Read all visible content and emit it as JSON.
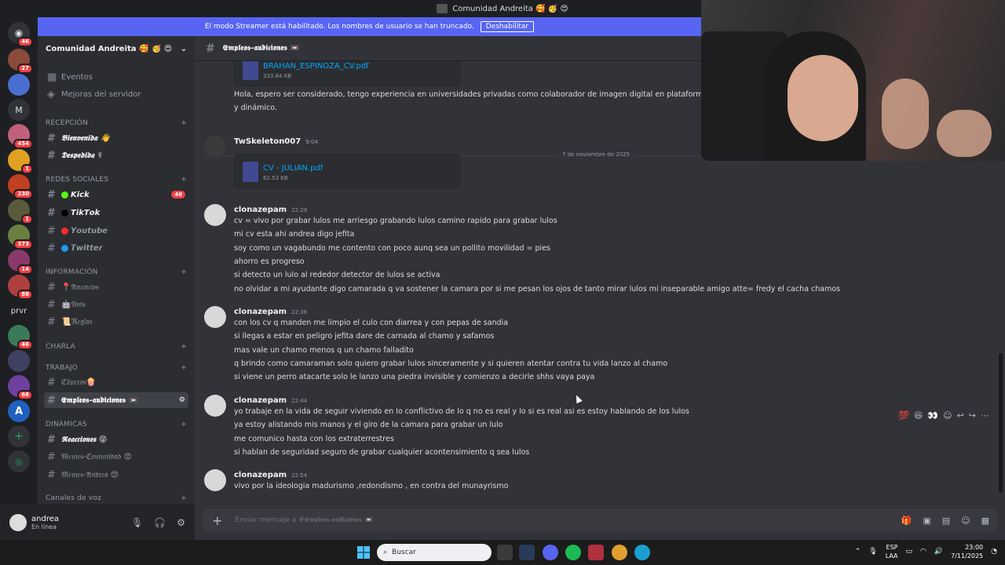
{
  "window": {
    "title": "Comunidad Andreita 🥰 🥳 😍"
  },
  "banner": {
    "text": "El modo Streamer está habilitado. Los nombres de usuario se han truncado.",
    "button": "Deshabilitar"
  },
  "guild_badges": [
    "46",
    "27",
    "454",
    "1",
    "230",
    "1",
    "373",
    "14",
    "88",
    "46",
    "68"
  ],
  "guild_text": {
    "m": "M",
    "prvr": "prvr"
  },
  "server": {
    "name": "Comunidad Andreita 🥰 🥳 😍"
  },
  "sidebar": {
    "top_items": [
      "Eventos",
      "Mejoras del servidor"
    ],
    "categories": {
      "recepcion": "RECEPCIÓN",
      "redes": "REDES SOCIALES",
      "informacion": "INFORMACIÓN",
      "charla": "CHARLA",
      "trabajo": "TRABAJO",
      "dinamicas": "DINAMICAS",
      "voz": "Canales de voz"
    },
    "channels": {
      "bienvenida": "𝕭𝖎𝖊𝖓𝖛𝖊𝖓𝖎𝖉𝖆 👋",
      "despedida": "𝕯𝖊𝖘𝖕𝖊𝖉𝖎𝖉𝖆 ✌",
      "kick": "𝙆𝙞𝙘𝙠",
      "tiktok": "𝙏𝙞𝙠𝙏𝙤𝙠",
      "youtube": "𝙔𝙤𝙪𝙩𝙪𝙗𝙚",
      "twitter": "𝙏𝙬𝙞𝙩𝙩𝙚𝙧",
      "anuncios": "📍𝔄𝔫𝔲𝔫𝔠𝔦𝔬𝔰",
      "bots": "🤖𝔅𝔬𝔱𝔰",
      "reglas": "📜ℜ𝔢𝔤𝔩𝔞𝔰",
      "clipers": "ℭ𝔩𝔦𝔭𝔢𝔯𝔬𝔰🍿",
      "empleos": "𝕰𝖒𝖕𝖑𝖊𝖔𝖘-𝖆𝖚𝖉𝖎𝖈𝖎𝖔𝖓𝖊𝖘 📼",
      "reacciones": "𝕽𝖊𝖆𝖈𝖈𝖎𝖔𝖓𝖊𝖘 😝",
      "memes_comunidad": "𝔐𝔢𝔪𝔢𝔰-ℭ𝔬𝔪𝔲𝔫𝔦𝔡𝔞𝔡 😡",
      "memes_andrea": "𝔐𝔢𝔪𝔢𝔰-𝔄𝔫𝔡𝔯𝔢𝔞 😍"
    },
    "kick_badge": "46"
  },
  "user": {
    "name": "andrea",
    "status": "En línea"
  },
  "channel_header": {
    "name": "𝕰𝖒𝖕𝖑𝖊𝖔𝖘-𝖆𝖚𝖉𝖎𝖈𝖎𝖔𝖓𝖊𝖘 📼"
  },
  "messages": {
    "attach1": {
      "name": "BRAHAN_ESPINOZA_CV.pdf",
      "size": "333.64 KB"
    },
    "prev_text1": "Hola, espero ser considerado, tengo experiencia en universidades privadas como colaborador de imagen digital en plataformas. Tam",
    "prev_text2": "y dinámico.",
    "date_divider": "7 de noviembre de 2025",
    "m1": {
      "user": "TwSkeleton007",
      "time": "9:04",
      "file": "CV - JULIAN.pdf",
      "size": "62.53 KB"
    },
    "m2": {
      "user": "clonazepam",
      "time": "22:29",
      "lines": [
        "cv = vivo por grabar lulos me arriesgo grabando lulos   camino rapido para grabar lulos",
        "mi cv esta ahi andrea digo jefita",
        "soy como un vagabundo me contento con poco aunq sea un pollito movilidad = pies",
        "ahorro es progreso",
        "si detecto un lulo al rededor detector de lulos se activa",
        "no olvidar a mi ayudante digo camarada q va sostener la camara   por si me pesan los ojos de tanto mirar lulos mi  inseparable amigo  atte= fredy  el cacha chamos"
      ]
    },
    "m3": {
      "user": "clonazepam",
      "time": "22:36",
      "lines": [
        "con los cv q manden me limpio el culo con diarrea y con pepas de sandia",
        "si llegas a estar en peligro jefita  dare de carnada al chamo y safamos",
        "mas vale un chamo menos  q un chamo  falladito",
        "q brindo como camaraman solo quiero grabar lulos sinceramente y si quieren atentar contra tu vida lanzo al chamo",
        "si viene un perro atacarte solo le lanzo una piedra invisible y comienzo a decirle shhs vaya paya"
      ]
    },
    "m4": {
      "user": "clonazepam",
      "time": "22:44",
      "lines": [
        "yo trabaje en la vida de seguir viviendo en lo conflictivo de lo q no es real y lo si es real asi es estoy hablando de los lulos",
        "ya estoy alistando mis manos y el giro de la camara para grabar un lulo",
        "me comunico hasta con los extraterrestres",
        "si hablan de seguridad seguro de grabar cualquier acontensimiento q sea lulos"
      ]
    },
    "m5": {
      "user": "clonazepam",
      "time": "22:54",
      "lines": [
        "vivo por la ideologia madurismo ,redondismo , en contra del munayrismo"
      ]
    }
  },
  "input": {
    "placeholder": "Enviar mensaje a #𝕰𝖒𝖕𝖑𝖊𝖔𝖘-𝖆𝖚𝖉𝖎𝖈𝖎𝖔𝖓𝖊𝖘 📼"
  },
  "taskbar": {
    "search": "Buscar",
    "lang1": "ESP",
    "lang2": "LAA",
    "time": "23:00",
    "date": "7/11/2025"
  }
}
